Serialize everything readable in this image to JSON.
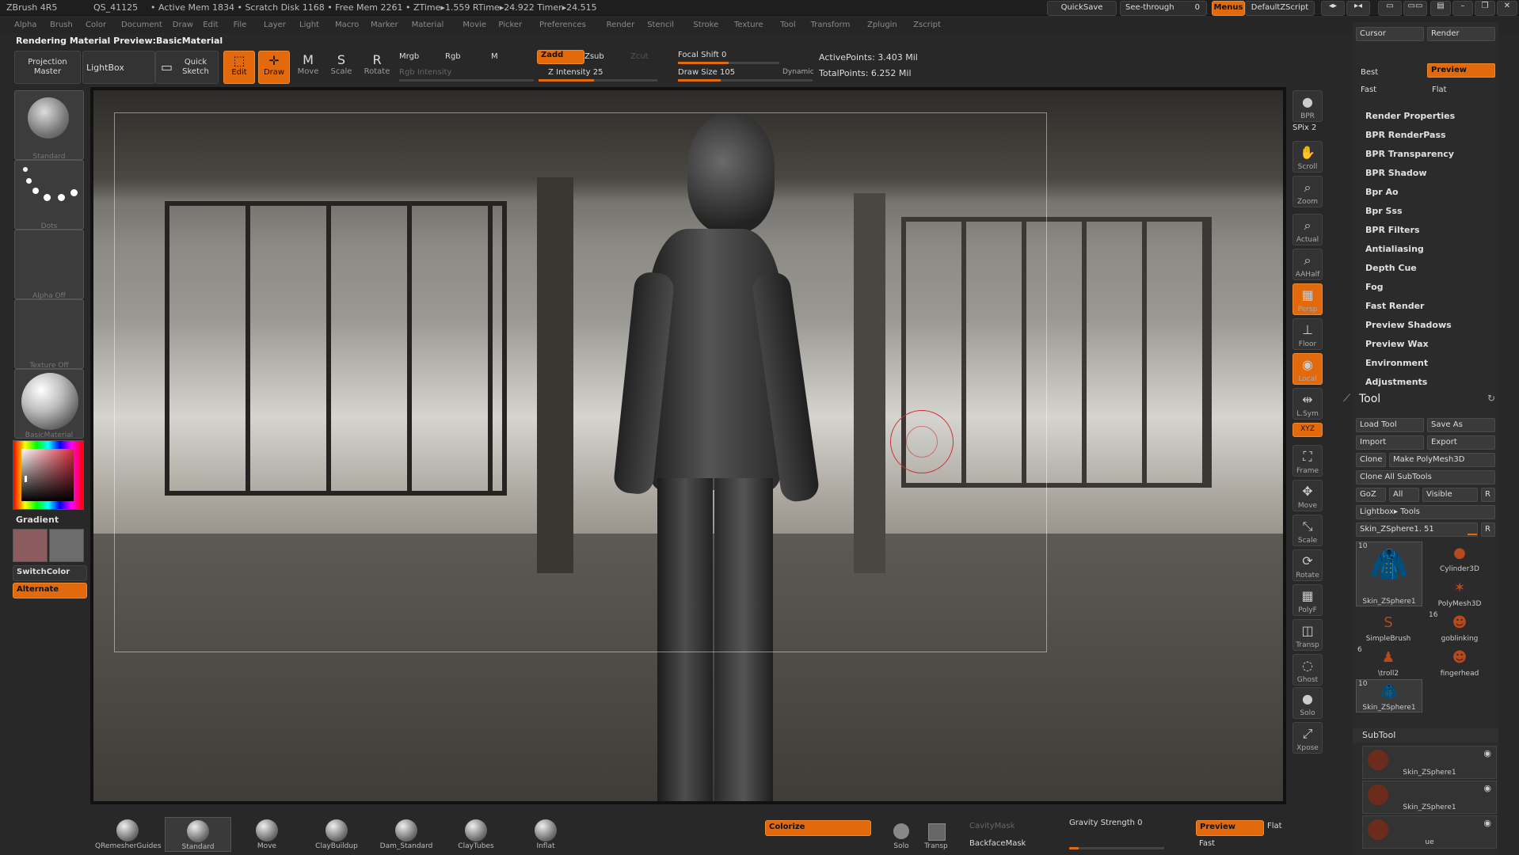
{
  "topbar": {
    "app": "ZBrush 4R5",
    "qs": "QS_41125",
    "stats": "• Active Mem 1834 • Scratch Disk 1168 • Free Mem 2261 • ZTime▸1.559 RTime▸24.922 Timer▸24.515",
    "quicksave": "QuickSave",
    "seethrough": "See-through",
    "seethrough_val": "0",
    "menus": "Menus",
    "script": "DefaultZScript"
  },
  "menubar": [
    "Alpha",
    "Brush",
    "Color",
    "Document",
    "Draw",
    "Edit",
    "File",
    "Layer",
    "Light",
    "Macro",
    "Marker",
    "Material",
    "Movie",
    "Picker",
    "Preferences",
    "Render",
    "Stencil",
    "Stroke",
    "Texture",
    "Tool",
    "Transform",
    "Zplugin",
    "Zscript"
  ],
  "title": "Rendering Material Preview:BasicMaterial",
  "toolbar": {
    "projection_master": "Projection Master",
    "lightbox": "LightBox",
    "quick_sketch": "Quick Sketch",
    "edit": "Edit",
    "draw": "Draw",
    "move": "Move",
    "scale": "Scale",
    "rotate": "Rotate",
    "mrgb": "Mrgb",
    "rgb": "Rgb",
    "m": "M",
    "rgb_intensity": "Rgb Intensity",
    "zadd": "Zadd",
    "zsub": "Zsub",
    "zcut": "Zcut",
    "z_intensity": "Z Intensity 25",
    "focal_shift": "Focal Shift 0",
    "draw_size": "Draw Size 105",
    "dynamic": "Dynamic",
    "active_points": "ActivePoints: 3.403 Mil",
    "total_points": "TotalPoints: 6.252 Mil"
  },
  "left": {
    "brush": "Standard",
    "stroke": "Dots",
    "alpha": "Alpha Off",
    "texture": "Texture Off",
    "material": "BasicMaterial",
    "gradient": "Gradient",
    "switchcolor": "SwitchColor",
    "alternate": "Alternate"
  },
  "rightstrip": [
    {
      "label": "BPR",
      "icon": "●"
    },
    {
      "label": "Scroll",
      "icon": "✋"
    },
    {
      "label": "Zoom",
      "icon": "⌕"
    },
    {
      "label": "Actual",
      "icon": "⌕"
    },
    {
      "label": "AAHalf",
      "icon": "⌕"
    },
    {
      "label": "Persp",
      "icon": "▦"
    },
    {
      "label": "Floor",
      "icon": "⊥"
    },
    {
      "label": "Local",
      "icon": "◉"
    },
    {
      "label": "L.Sym",
      "icon": "⇹"
    },
    {
      "label": "Frame",
      "icon": "⛶"
    },
    {
      "label": "Move",
      "icon": "✥"
    },
    {
      "label": "Scale",
      "icon": "⤡"
    },
    {
      "label": "Rotate",
      "icon": "⟳"
    },
    {
      "label": "PolyF",
      "icon": "▦"
    },
    {
      "label": "Transp",
      "icon": "◫"
    },
    {
      "label": "Ghost",
      "icon": "◌"
    },
    {
      "label": "Solo",
      "icon": "●"
    },
    {
      "label": "Xpose",
      "icon": "⤢"
    }
  ],
  "spix": "SPix 2",
  "xyz": "XYZ",
  "render_panel": {
    "cursor": "Cursor",
    "render": "Render",
    "best": "Best",
    "preview": "Preview",
    "fast": "Fast",
    "flat": "Flat",
    "items": [
      "Render Properties",
      "BPR RenderPass",
      "BPR Transparency",
      "BPR Shadow",
      "Bpr Ao",
      "Bpr Sss",
      "BPR Filters",
      "Antialiasing",
      "Depth Cue",
      "Fog",
      "Fast Render",
      "Preview Shadows",
      "Preview Wax",
      "Environment",
      "Adjustments"
    ]
  },
  "tool_panel": {
    "title": "Tool",
    "load_tool": "Load Tool",
    "save_as": "Save As",
    "import": "Import",
    "export": "Export",
    "clone": "Clone",
    "make_polymesh": "Make PolyMesh3D",
    "clone_all": "Clone All SubTools",
    "goz": "GoZ",
    "all": "All",
    "visible": "Visible",
    "r": "R",
    "lightbox_tools": "Lightbox▸ Tools",
    "current_tool": "Skin_ZSphere1. 51",
    "thumbs": [
      {
        "label": "Skin_ZSphere1",
        "badge": "10",
        "icon": "🧥"
      },
      {
        "label": "Cylinder3D",
        "badge": "",
        "icon": "●"
      },
      {
        "label": "PolyMesh3D",
        "badge": "",
        "icon": "✶"
      },
      {
        "label": "SimpleBrush",
        "badge": "",
        "icon": "S"
      },
      {
        "label": "goblinking",
        "badge": "16",
        "icon": "☻"
      },
      {
        "label": "\\troll2",
        "badge": "6",
        "icon": "♟"
      },
      {
        "label": "fingerhead",
        "badge": "",
        "icon": "☻"
      },
      {
        "label": "Skin_ZSphere1",
        "badge": "10",
        "icon": "🧥"
      }
    ]
  },
  "subtool": {
    "title": "SubTool",
    "items": [
      "Skin_ZSphere1",
      "Skin_ZSphere1",
      "ue"
    ]
  },
  "bottom": {
    "brushes": [
      "QRemesherGuides",
      "Standard",
      "Move",
      "ClayBuildup",
      "Dam_Standard",
      "ClayTubes",
      "Inflat"
    ],
    "colorize": "Colorize",
    "solo": "Solo",
    "transp": "Transp",
    "cavitymask": "CavityMask",
    "backfacemask": "BackfaceMask",
    "gravity": "Gravity Strength 0",
    "preview": "Preview",
    "flat": "Flat",
    "fast": "Fast"
  },
  "colors": {
    "accent": "#e26a0c"
  }
}
